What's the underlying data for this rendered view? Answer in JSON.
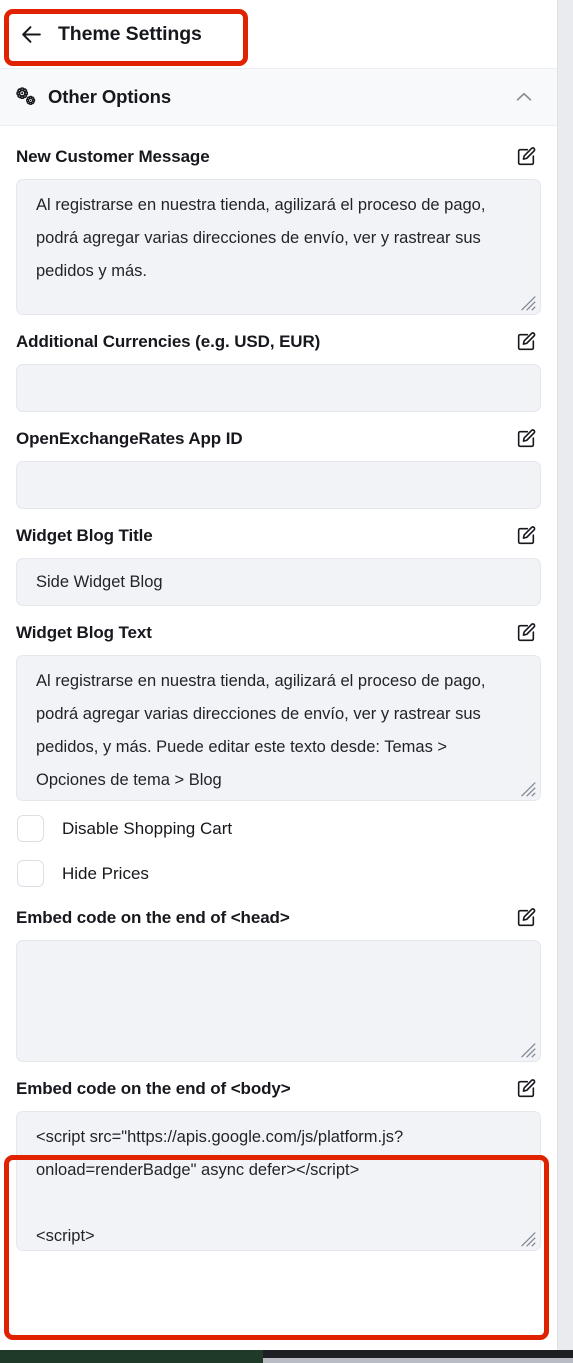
{
  "topbar": {
    "back_icon": "arrow-left-icon",
    "title": "Theme Settings"
  },
  "section": {
    "icon": "gears-icon",
    "title": "Other Options",
    "chevron": "chevron-up-icon",
    "expanded": true
  },
  "edit_icon_name": "edit-pencil-icon",
  "fields": {
    "new_customer_message": {
      "label": "New Customer Message",
      "value": "Al registrarse en nuestra tienda, agilizará el proceso de pago, podrá agregar varias direcciones de envío, ver y rastrear sus pedidos y más.",
      "edit_label": "Edit"
    },
    "additional_currencies": {
      "label": "Additional Currencies (e.g. USD, EUR)",
      "value": "",
      "placeholder": ""
    },
    "openexchangerates_app_id": {
      "label": "OpenExchangeRates App ID",
      "value": "",
      "placeholder": ""
    },
    "widget_blog_title": {
      "label": "Widget Blog Title",
      "value": "Side Widget Blog"
    },
    "widget_blog_text": {
      "label": "Widget Blog Text",
      "value": "Al registrarse en nuestra tienda, agilizará el proceso de pago, podrá agregar varias direcciones de envío, ver y rastrear sus pedidos, y más. Puede editar este texto desde: Temas > Opciones de tema > Blog"
    },
    "embed_head": {
      "label": "Embed code on the end of <head>",
      "value": ""
    },
    "embed_body": {
      "label": "Embed code on the end of <body>",
      "value": "<script src=\"https://apis.google.com/js/platform.js?onload=renderBadge\" async defer></script>\n\n<script>"
    }
  },
  "checkboxes": [
    {
      "label": "Disable Shopping Cart",
      "checked": false
    },
    {
      "label": "Hide Prices",
      "checked": false
    }
  ],
  "colors": {
    "annotation": "#e02200",
    "field_bg": "#f1f3f6",
    "section_bg": "#f8f9fa",
    "text": "#16181d"
  }
}
